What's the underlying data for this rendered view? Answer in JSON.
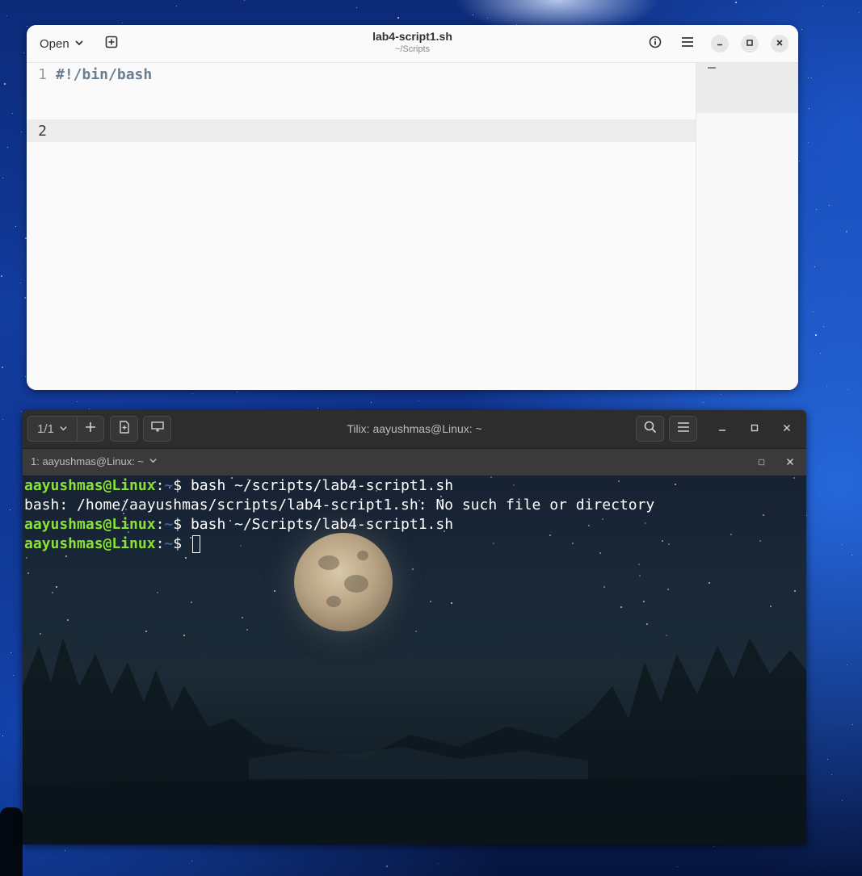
{
  "editor": {
    "title": "lab4-script1.sh",
    "subtitle": "~/Scripts",
    "open_label": "Open",
    "lines": [
      {
        "number": "1",
        "text": "#!/bin/bash"
      },
      {
        "number": "2",
        "text": ""
      }
    ],
    "icons": {
      "new_tab": "new-tab-icon",
      "info": "info-icon",
      "menu": "hamburger-menu-icon",
      "minimize": "minimize-icon",
      "maximize": "maximize-icon",
      "close": "close-icon"
    }
  },
  "terminal": {
    "title": "Tilix: aayushmas@Linux: ~",
    "session_selector": "1/1",
    "tab_label": "1: aayushmas@Linux: ~",
    "lines": [
      {
        "user": "aayushmas@Linux",
        "sep": ":",
        "path": "~",
        "prompt": "$ ",
        "text": "bash ~/scripts/lab4-script1.sh"
      },
      {
        "output": "bash: /home/aayushmas/scripts/lab4-script1.sh: No such file or directory"
      },
      {
        "user": "aayushmas@Linux",
        "sep": ":",
        "path": "~",
        "prompt": "$ ",
        "text": "bash ~/Scripts/lab4-script1.sh"
      },
      {
        "user": "aayushmas@Linux",
        "sep": ":",
        "path": "~",
        "prompt": "$ ",
        "text": ""
      }
    ],
    "colors": {
      "user": "#8ae234",
      "path": "#3465a4",
      "text": "#ffffff"
    }
  }
}
